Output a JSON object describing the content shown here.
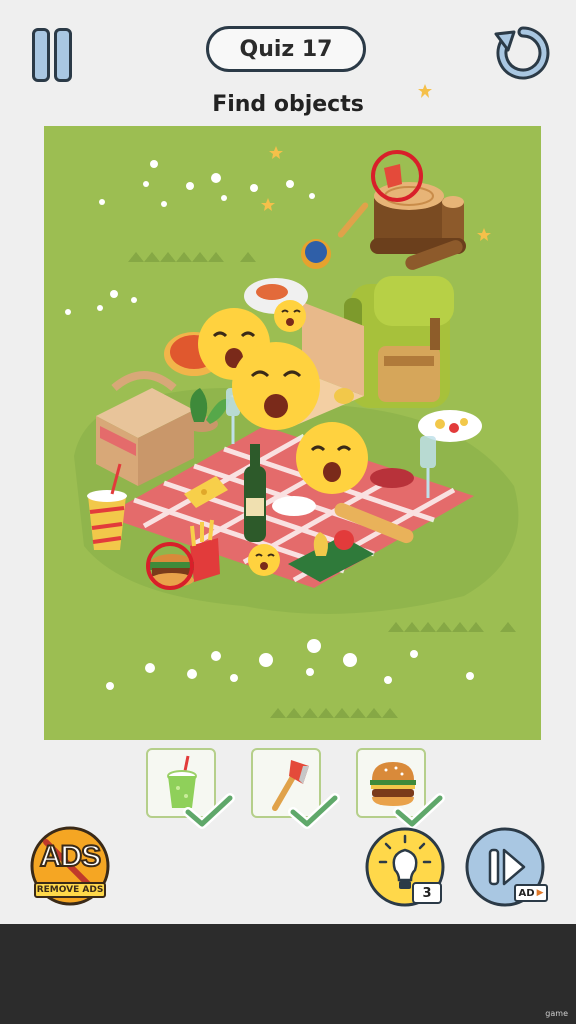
{
  "header": {
    "quiz_label": "Quiz 17",
    "instruction": "Find objects"
  },
  "icons": {
    "pause": "pause-icon",
    "restart": "restart-icon",
    "hint": "lightbulb-icon",
    "skip": "skip-forward-icon"
  },
  "targets": [
    {
      "name": "green-juice-cup",
      "found": true
    },
    {
      "name": "axe",
      "found": true
    },
    {
      "name": "burger",
      "found": true
    }
  ],
  "bottom": {
    "ads_label": "ADS",
    "remove_ads_label": "REMOVE ADS",
    "hint_count": "3",
    "ad_label": "AD"
  },
  "footer": {
    "tag": "game"
  },
  "colors": {
    "grass": "#9cbe52",
    "slot_border": "#b5cf8a",
    "check": "#5fa86a",
    "found_circle": "#d81f2a",
    "ads_orange": "#f5a623",
    "hint_yellow": "#ffd84a",
    "skip_blue": "#a9c7e2"
  }
}
